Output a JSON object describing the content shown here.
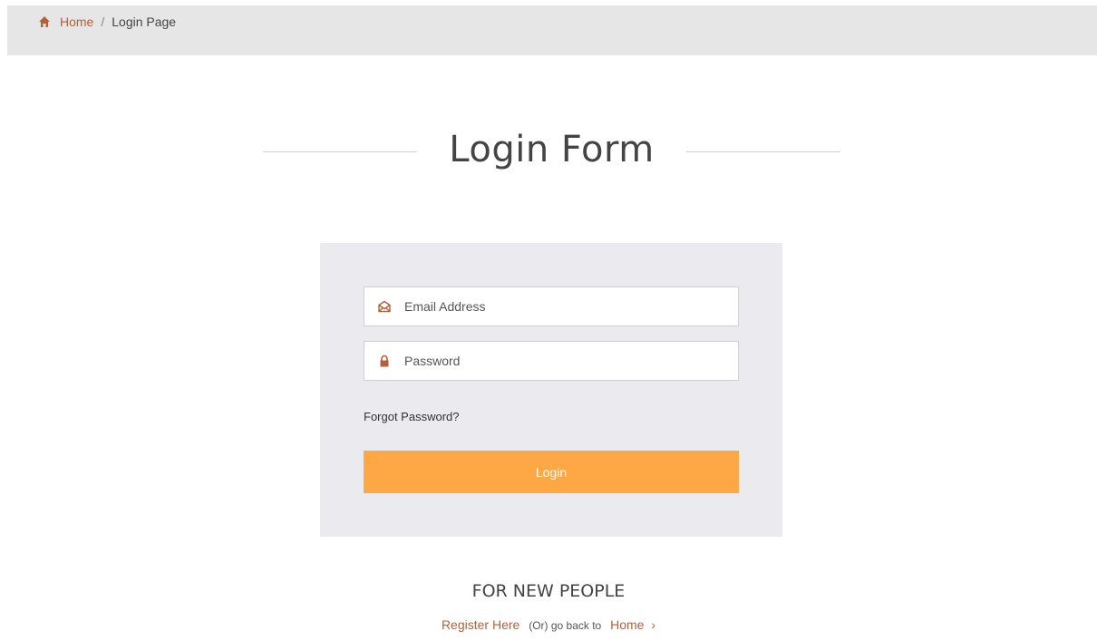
{
  "breadcrumb": {
    "home_label": "Home",
    "separator": "/",
    "current": "Login Page"
  },
  "title": "Login Form",
  "form": {
    "email_placeholder": "Email Address",
    "password_placeholder": "Password",
    "forgot_label": "Forgot Password?",
    "login_label": "Login"
  },
  "footer": {
    "heading": "FOR NEW PEOPLE",
    "register_label": "Register Here",
    "middle_text": "(Or) go back to",
    "home_label": "Home",
    "chevron": "›"
  },
  "colors": {
    "accent": "#b5603a",
    "button": "#fda745",
    "panel": "#ebebef",
    "breadcrumb_bg": "#e6e6e6"
  },
  "icons": {
    "breadcrumb": "home-icon",
    "email": "envelope-icon",
    "password": "lock-icon"
  }
}
